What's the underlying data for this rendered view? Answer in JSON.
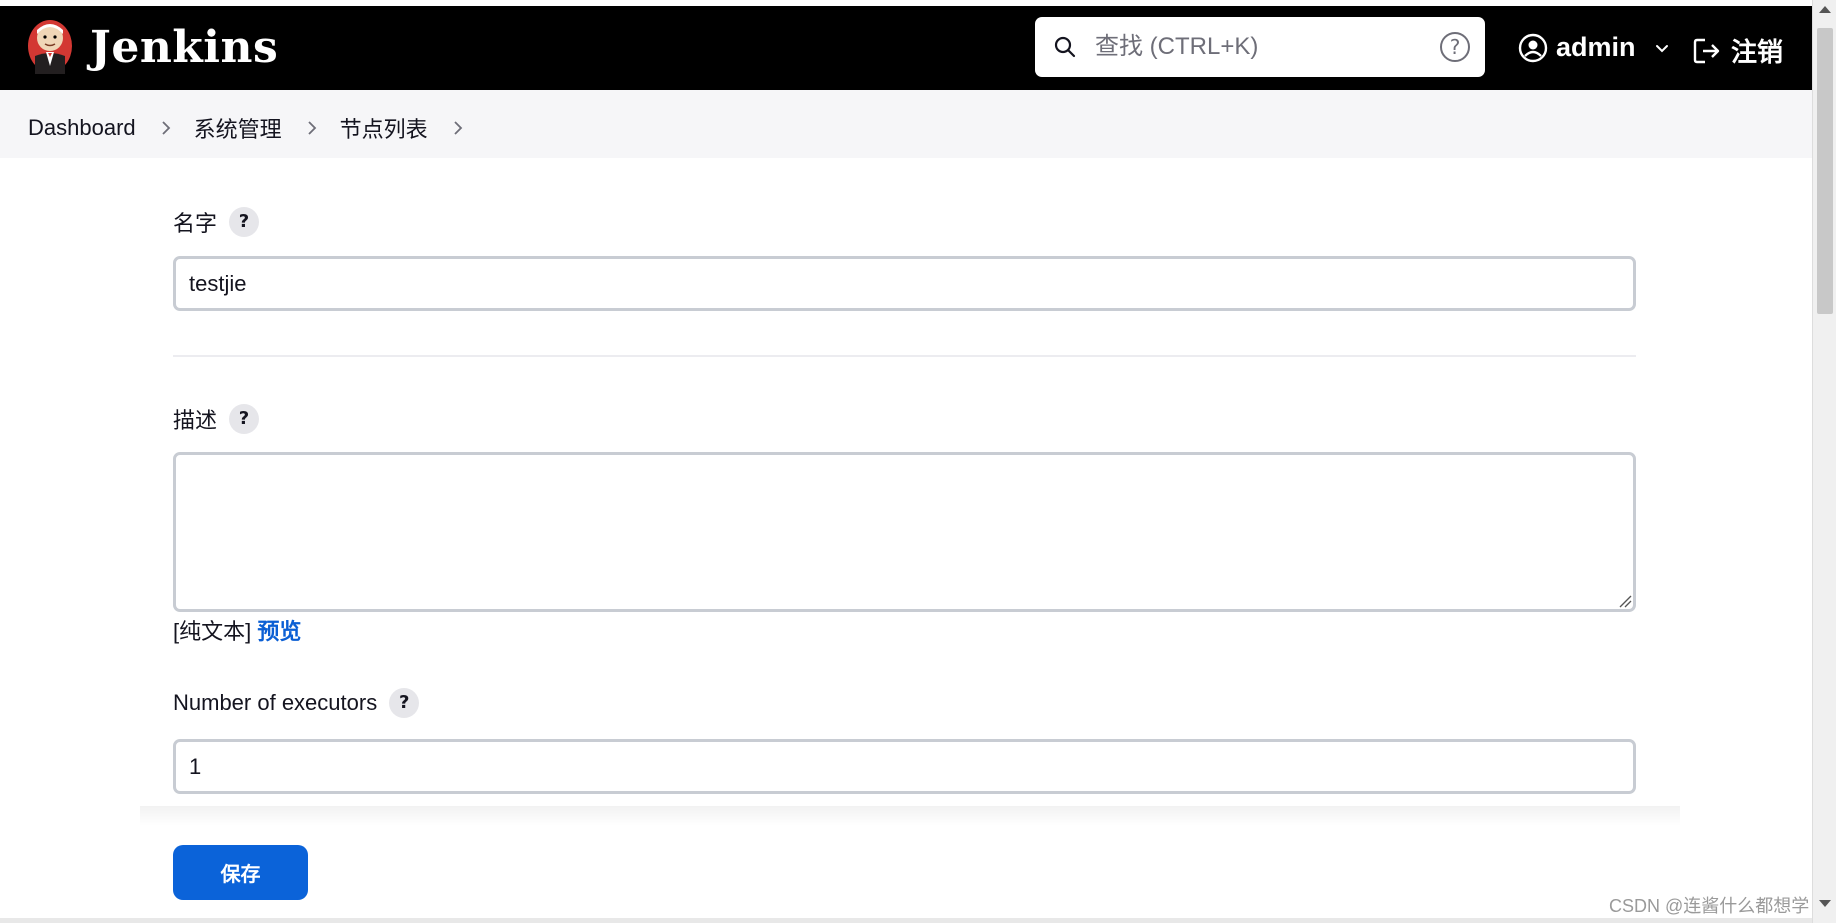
{
  "header": {
    "brand": "Jenkins",
    "search_placeholder": "查找 (CTRL+K)",
    "help_glyph": "?",
    "user_name": "admin",
    "logout_label": "注销"
  },
  "breadcrumb": [
    "Dashboard",
    "系统管理",
    "节点列表"
  ],
  "form": {
    "name_label": "名字",
    "name_value": "testjie",
    "description_label": "描述",
    "description_value": "",
    "plain_text_label": "[纯文本]",
    "preview_link": "预览",
    "executors_label": "Number of executors",
    "executors_value": "1",
    "help_glyph": "?",
    "save_label": "保存"
  },
  "watermark": "CSDN @连酱什么都想学",
  "colors": {
    "header_bg": "#000000",
    "breadcrumb_bg": "#f6f6f8",
    "accent_button": "#0b63d9",
    "link": "#0b5fd4",
    "input_border": "#c8ccd3"
  },
  "icons": [
    "jenkins-logo-icon",
    "search-icon",
    "help-icon",
    "user-icon",
    "chevron-down-icon",
    "logout-icon",
    "chevron-right-icon",
    "resize-grip-icon"
  ]
}
